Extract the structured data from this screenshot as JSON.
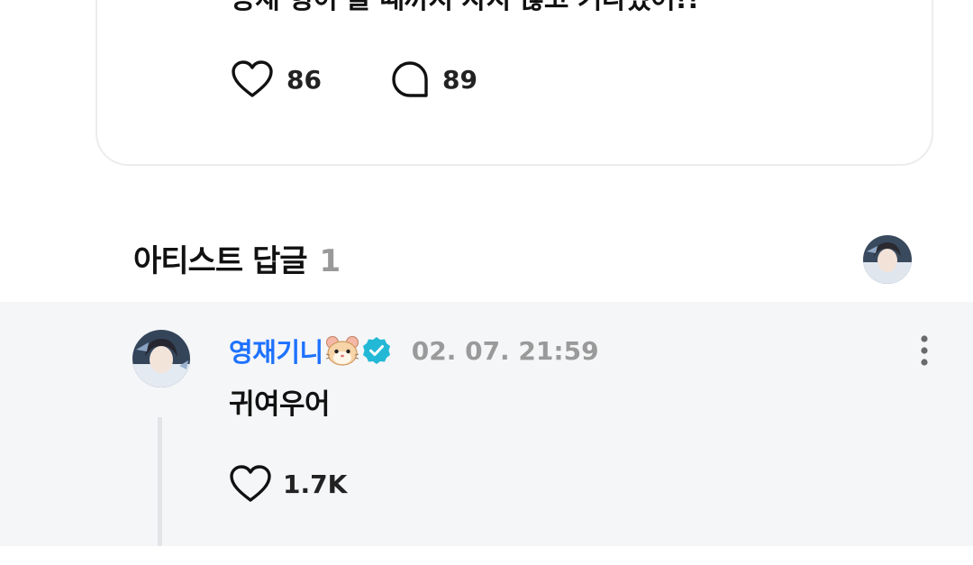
{
  "post": {
    "text": "용재 형이 올 때까지 자지 않고 기다렸어!!",
    "like_count": "86",
    "comment_count": "89"
  },
  "section": {
    "title": "아티스트 답글",
    "count": "1"
  },
  "reply": {
    "author": "영재기니",
    "author_emoji": "hamster-face",
    "verified": true,
    "timestamp": "02. 07. 21:59",
    "body": "귀여우어",
    "like_count": "1.7K"
  },
  "colors": {
    "author_name": "#1e72ff",
    "verified_badge": "#22b8d6",
    "timestamp": "#9a9a9a",
    "section_count": "#999999",
    "reply_background": "#f5f6f8",
    "card_border": "#ececec"
  },
  "icons": {
    "like": "heart-outline-icon",
    "comment": "speech-bubble-outline-icon",
    "more": "vertical-ellipsis-icon",
    "verified": "verified-badge-icon"
  }
}
